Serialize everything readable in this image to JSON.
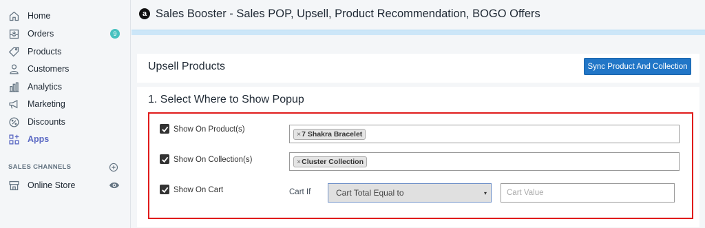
{
  "sidebar": {
    "items": [
      {
        "label": "Home",
        "icon": "home-icon"
      },
      {
        "label": "Orders",
        "icon": "orders-icon",
        "badge": "9"
      },
      {
        "label": "Products",
        "icon": "tag-icon"
      },
      {
        "label": "Customers",
        "icon": "person-icon"
      },
      {
        "label": "Analytics",
        "icon": "bar-chart-icon"
      },
      {
        "label": "Marketing",
        "icon": "megaphone-icon"
      },
      {
        "label": "Discounts",
        "icon": "discount-icon"
      },
      {
        "label": "Apps",
        "icon": "apps-icon",
        "active": true
      }
    ],
    "channels_heading": "SALES CHANNELS",
    "channel_item": {
      "label": "Online Store",
      "icon": "store-icon"
    }
  },
  "app": {
    "logo_letter": "a",
    "title": "Sales Booster - Sales POP, Upsell, Product Recommendation, BOGO Offers"
  },
  "upsell_card": {
    "title": "Upsell Products",
    "sync_button": "Sync Product And Collection"
  },
  "popup_section": {
    "title": "1. Select Where to Show Popup",
    "rows": [
      {
        "label": "Show On Product(s)",
        "checked": true,
        "tag": "7 Shakra Bracelet"
      },
      {
        "label": "Show On Collection(s)",
        "checked": true,
        "tag": "Cluster Collection"
      },
      {
        "label": "Show On Cart",
        "checked": true
      }
    ],
    "cart_if_label": "Cart If",
    "cart_condition_selected": "Cart Total Equal to",
    "cart_value_placeholder": "Cart Value",
    "tag_remove_glyph": "×",
    "select_arrow_glyph": "▾"
  },
  "colors": {
    "accent": "#5c6ac4",
    "primary_button": "#2176c7",
    "highlight_border": "#e01b1b",
    "badge": "#47c1bf"
  }
}
